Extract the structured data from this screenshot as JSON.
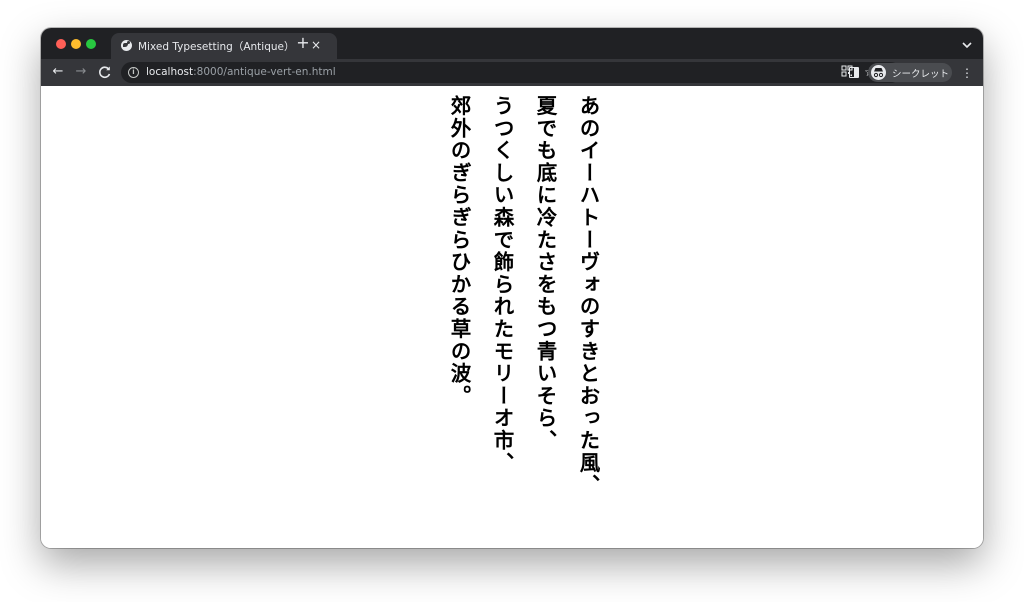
{
  "browser": {
    "tab": {
      "title": "Mixed Typesetting（Antique）",
      "close_glyph": "×"
    },
    "new_tab_glyph": "+",
    "tab_menu_icon": "chevron-down-icon",
    "nav": {
      "back_glyph": "←",
      "forward_glyph": "→",
      "reload_glyph": "C"
    },
    "address": {
      "host": "localhost",
      "rest": ":8000/antique-vert-en.html"
    },
    "profile": {
      "label": "シークレット"
    },
    "menu_glyph": "⋮"
  },
  "page": {
    "lines": [
      "あのイーハトーヴォのすきとおった風、",
      "夏でも底に冷たさをもつ青いそら、",
      "うつくしい森で飾られたモリーオ市、",
      "郊外のぎらぎらひかる草の波。"
    ]
  }
}
